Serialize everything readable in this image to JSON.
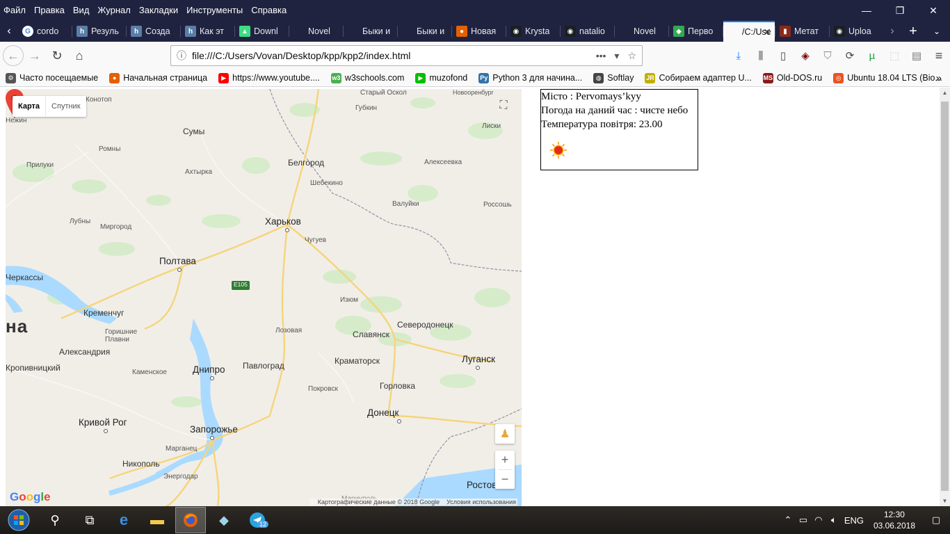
{
  "menubar": {
    "items": [
      "Файл",
      "Правка",
      "Вид",
      "Журнал",
      "Закладки",
      "Инструменты",
      "Справка"
    ]
  },
  "tabs": [
    {
      "label": "cordo",
      "icon": "google-icon"
    },
    {
      "label": "Резуль",
      "icon": "h-icon"
    },
    {
      "label": "Созда",
      "icon": "h-icon"
    },
    {
      "label": "Как эт",
      "icon": "h-icon"
    },
    {
      "label": "Downl",
      "icon": "android-icon"
    },
    {
      "label": "Novel",
      "icon": "blank-icon"
    },
    {
      "label": "Быки и ко",
      "icon": "blank-icon"
    },
    {
      "label": "Быки и ко",
      "icon": "blank-icon"
    },
    {
      "label": "Новая",
      "icon": "firefox-icon"
    },
    {
      "label": "Krysta",
      "icon": "github-icon"
    },
    {
      "label": "natalio",
      "icon": "github-icon"
    },
    {
      "label": "Novel",
      "icon": "blank-icon"
    },
    {
      "label": "Перво",
      "icon": "maps-icon"
    },
    {
      "label": "/C:/Use",
      "icon": "blank-icon",
      "active": true
    },
    {
      "label": "Метат",
      "icon": "metatrader-icon"
    },
    {
      "label": "Uploa",
      "icon": "github-icon"
    }
  ],
  "navbar": {
    "url": "file:///C:/Users/Vovan/Desktop/kpp/kpp2/index.html",
    "more_label": "•••"
  },
  "bookmarks": [
    {
      "label": "Часто посещаемые",
      "icon": "gear-icon",
      "color": "#555555"
    },
    {
      "label": "Начальная страница",
      "icon": "firefox-icon",
      "color": "#e66000"
    },
    {
      "label": "https://www.youtube....",
      "icon": "youtube-icon",
      "color": "#ff0000"
    },
    {
      "label": "w3schools.com",
      "icon": "w3schools-icon",
      "color": "#4caf50"
    },
    {
      "label": "muzofond",
      "icon": "play-icon",
      "color": "#00c000"
    },
    {
      "label": "Python 3 для начина...",
      "icon": "python-icon",
      "color": "#3572a5"
    },
    {
      "label": "Softlay",
      "icon": "globe-icon",
      "color": "#444444"
    },
    {
      "label": "Собираем адаптер U...",
      "icon": "jr-icon",
      "color": "#c0b000"
    },
    {
      "label": "Old-DOS.ru",
      "icon": "msdos-icon",
      "color": "#8b1a1a"
    },
    {
      "label": "Ubuntu 18.04 LTS (Bio...",
      "icon": "ubuntu-icon",
      "color": "#e95420"
    }
  ],
  "map": {
    "type_buttons": {
      "map": "Карта",
      "satellite": "Спутник"
    },
    "cities_major": [
      {
        "name": "Харьков"
      },
      {
        "name": "Полтава"
      },
      {
        "name": "Днипро"
      },
      {
        "name": "Запорожье"
      },
      {
        "name": "Кривой Рог"
      },
      {
        "name": "Донецк"
      },
      {
        "name": "Луганск"
      },
      {
        "name": "Кременчуг"
      },
      {
        "name": "Александрия"
      },
      {
        "name": "Белгород"
      },
      {
        "name": "Сумы"
      }
    ],
    "cities_minor": [
      "Старый Оскол",
      "Губкин",
      "Новооренбург",
      "Лиски",
      "Конотоп",
      "Нежин",
      "Ромны",
      "Прилуки",
      "Ахтырка",
      "Шебекино",
      "Алексеевка",
      "Валуйки",
      "Россошь",
      "Лубны",
      "Миргород",
      "Чугуев",
      "Черкассы",
      "Изюм",
      "Северодонецк",
      "Славянск",
      "Лозовая",
      "Горишние Плавни",
      "Краматорск",
      "Кропивницкий",
      "Каменское",
      "Павлоград",
      "Горловка",
      "Покровск",
      "Марганец",
      "Никополь",
      "Энергодар",
      "Ростов",
      "Мариуполь"
    ],
    "road_label": "E105",
    "country_fragment": "на",
    "attribution": "Картографические данные © 2018 Google",
    "terms": "Условия использования",
    "logo": "Google"
  },
  "weather": {
    "city_line": "Місто : Pervomays’kyy",
    "condition_line": "Погода на даний час : чисте небо",
    "temp_line": "Температура повітря: 23.00",
    "icon": "sun-icon"
  },
  "taskbar": {
    "lang": "ENG",
    "time": "12:30",
    "date": "03.06.2018",
    "telegram_badge": "12"
  }
}
